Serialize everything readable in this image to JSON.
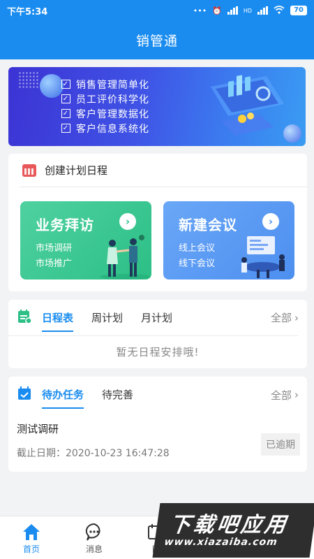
{
  "status": {
    "time": "下午5:34",
    "network": "HD",
    "battery": "70"
  },
  "app": {
    "title": "销管通"
  },
  "banner": {
    "items": [
      "销售管理简单化",
      "员工评价科学化",
      "客户管理数据化",
      "客户信息系统化"
    ]
  },
  "plan": {
    "title": "创建计划日程",
    "tiles": [
      {
        "title": "业务拜访",
        "lines": [
          "市场调研",
          "市场推广"
        ]
      },
      {
        "title": "新建会议",
        "lines": [
          "线上会议",
          "线下会议"
        ]
      }
    ]
  },
  "schedule": {
    "tabs": [
      "日程表",
      "周计划",
      "月计划"
    ],
    "all": "全部",
    "empty": "暂无日程安排哦!"
  },
  "todo": {
    "tabs": [
      "待办任务",
      "待完善"
    ],
    "all": "全部",
    "task": {
      "name": "测试调研",
      "due": "截止日期：2020-10-23 16:47:28",
      "badge": "已逾期"
    }
  },
  "tabbar": {
    "items": [
      "首页",
      "消息",
      "日"
    ]
  },
  "watermark": {
    "title": "下载吧应用",
    "url": "www.xiazaiba.com"
  },
  "colors": {
    "primary": "#1a8cf0",
    "green": "#2cbf86",
    "blue": "#4d8ff0",
    "red": "#e8585a"
  }
}
